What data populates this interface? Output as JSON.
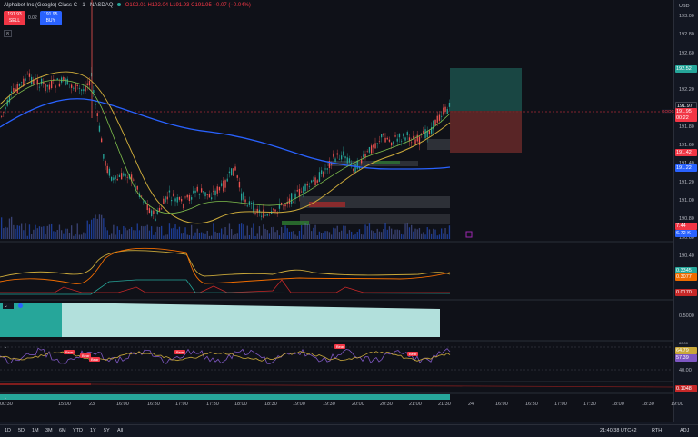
{
  "legend": {
    "title": "Alphabet Inc (Google) Class C · 1 · NASDAQ",
    "open": "O192.01",
    "high": "H192.04",
    "low": "L191.93",
    "close": "C191.95",
    "change": "−0.07 (−0.04%)"
  },
  "trade": {
    "sell_price": "191.93",
    "sell_label": "SELL",
    "spread": "0.02",
    "buy_price": "191.95",
    "buy_label": "BUY"
  },
  "collapse_label": "8",
  "currency": "USD",
  "price_axis": {
    "ticks": [
      "193.00",
      "192.80",
      "192.60",
      "192.40",
      "192.20",
      "192.00",
      "191.80",
      "191.60",
      "191.40",
      "191.20",
      "191.00",
      "190.80",
      "190.60",
      "190.40"
    ],
    "tag_target": "192.52",
    "tag_current": "191.97",
    "tag_last": "191.95",
    "tag_countdown": "00:22",
    "tag_symbol": "GOOG",
    "tag_stop": "191.42",
    "tag_ma": "191.22",
    "tag_vol1": "7.44",
    "tag_vol2": "6.72 K"
  },
  "pane2": {
    "tag_a": "0.3345",
    "tag_b": "0.3077",
    "tag_c": "0.0170"
  },
  "pane3": {
    "label": "0.5000"
  },
  "pane4": {
    "tag_a": "64.79",
    "tag_b": "57.39",
    "level": "40.00",
    "badge_label": "Bear",
    "top_label": "80.00"
  },
  "pane5": {
    "tag": "0.1048"
  },
  "time_axis": [
    "00:30",
    "15:00",
    "23",
    "16:00",
    "16:30",
    "17:00",
    "17:30",
    "18:00",
    "18:30",
    "19:00",
    "19:30",
    "20:00",
    "20:30",
    "21:00",
    "21:30",
    "24",
    "16:00",
    "16:30",
    "17:00",
    "17:30",
    "18:00",
    "18:30",
    "19:00"
  ],
  "bottom_bar": {
    "ranges": [
      "1D",
      "5D",
      "1M",
      "3M",
      "6M",
      "YTD",
      "1Y",
      "5Y",
      "All"
    ],
    "clock": "21:40:38 UTC+2",
    "session": "RTH",
    "adj": "ADJ"
  },
  "colors": {
    "up": "#26a69a",
    "down": "#ef5350",
    "ma_blue": "#2962ff",
    "ma_yellow": "#d4b84a",
    "ma_green": "#7fbf4c",
    "teal": "#4db6ac"
  }
}
